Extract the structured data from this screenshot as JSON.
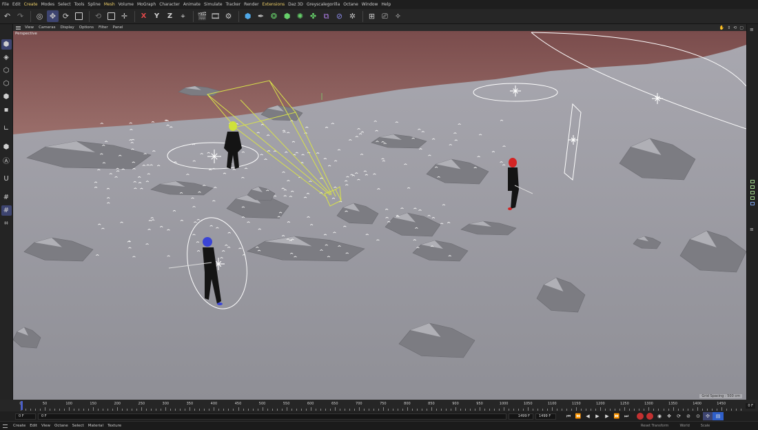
{
  "menu": [
    "File",
    "Edit",
    "Create",
    "Modes",
    "Select",
    "Tools",
    "Spline",
    "Mesh",
    "Volume",
    "MoGraph",
    "Character",
    "Animate",
    "Simulate",
    "Tracker",
    "Render",
    "Extensions",
    "Daz 3D",
    "Greyscalegorilla",
    "Octane",
    "Window",
    "Help"
  ],
  "menu_highlight": [
    "Create",
    "Mesh",
    "Extensions"
  ],
  "toolbar": {
    "axis_x": "X",
    "axis_y": "Y",
    "axis_z": "Z"
  },
  "viewport": {
    "menu": [
      "View",
      "Cameras",
      "Display",
      "Options",
      "Filter",
      "Panel"
    ],
    "label": "Perspective",
    "grid_spacing": "Grid Spacing : 500 cm"
  },
  "timeline": {
    "ticks": [
      "0",
      "50",
      "100",
      "150",
      "200",
      "250",
      "300",
      "350",
      "400",
      "450",
      "500",
      "550",
      "600",
      "650",
      "700",
      "750",
      "800",
      "850",
      "900",
      "950",
      "1000",
      "1050",
      "1100",
      "1150",
      "1200",
      "1250",
      "1300",
      "1350",
      "1400",
      "1450"
    ],
    "end_frame_display": "0 F"
  },
  "playback": {
    "current_frame": "0 F",
    "start_frame": "0 F",
    "end_frame_a": "1499 F",
    "end_frame_b": "1499 F"
  },
  "bottom": {
    "menu": [
      "Create",
      "Edit",
      "View",
      "Octane",
      "Select",
      "Material",
      "Texture"
    ],
    "right_labels": [
      "Reset Transform",
      "World",
      "Scale"
    ]
  },
  "colors": {
    "accent": "#3d4470",
    "highlight_menu": "#f2d36b",
    "ground": "#9a9aa2",
    "horizon": "#8a5f5c"
  }
}
